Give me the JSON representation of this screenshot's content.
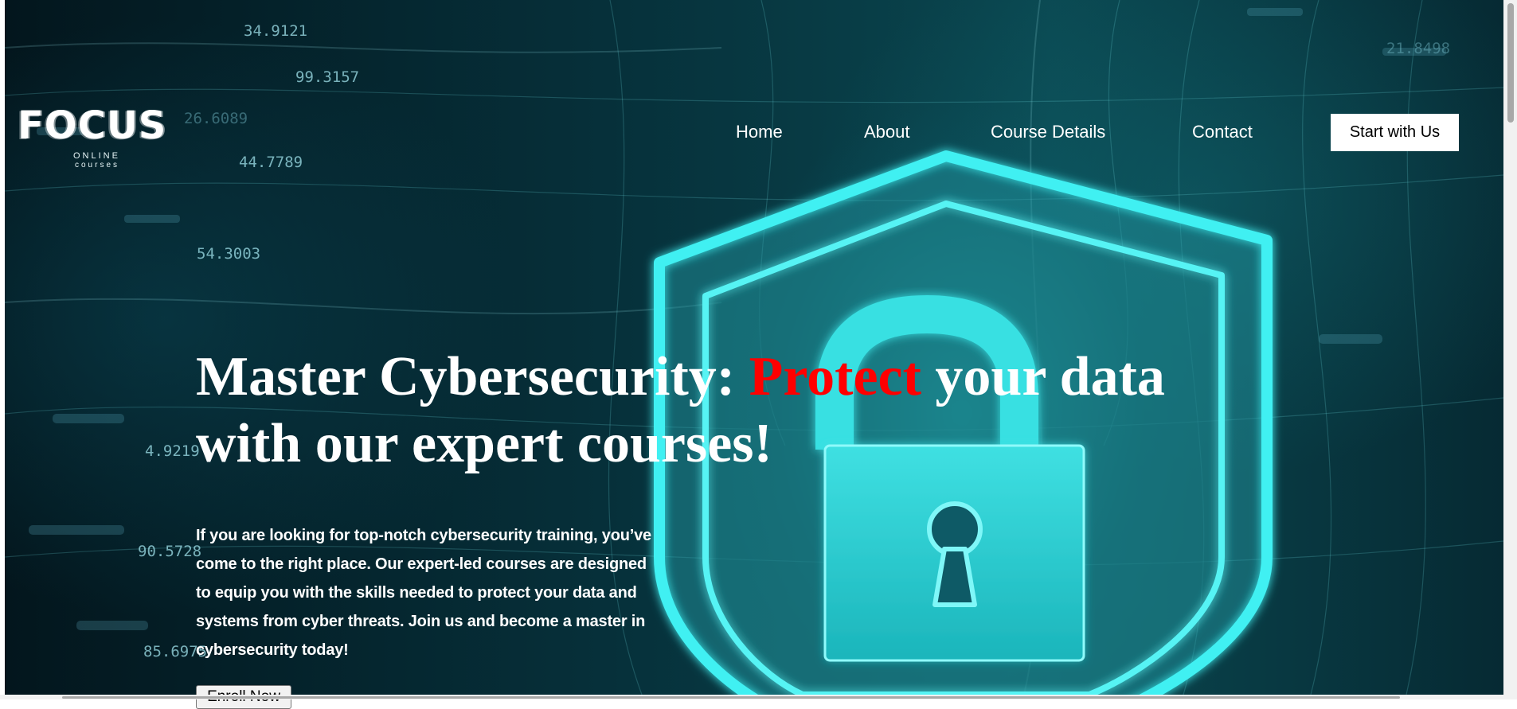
{
  "brand": {
    "logo_main": "FOCUS",
    "logo_sub_1": "ONLINE",
    "logo_sub_2": "courses"
  },
  "nav": {
    "items": [
      {
        "label": "Home"
      },
      {
        "label": "About"
      },
      {
        "label": "Course Details"
      },
      {
        "label": "Contact"
      }
    ],
    "cta_label": "Start with Us"
  },
  "hero": {
    "title_before": "Master Cybersecurity: ",
    "title_accent": "Protect",
    "title_after": " your data with our expert courses!",
    "description": "If you are looking for top-notch cybersecurity training, you’ve come to the right place. Our expert-led courses are designed to equip you with the skills needed to protect your data and systems from cyber threats. Join us and become a master in cybersecurity today!",
    "enroll_label": "Enroll Now"
  },
  "background": {
    "numbers": [
      "34.9121",
      "99.3157",
      "44.7789",
      "54.3003",
      "4.9219",
      "90.5728",
      "85.6975",
      "21.8498",
      "26.6089"
    ]
  },
  "colors": {
    "accent": "#ff0000",
    "background_deep": "#03161d",
    "background_cyan": "#28d2d7",
    "text": "#ffffff"
  },
  "icons": {
    "hero_graphic": "shield-lock-icon"
  }
}
